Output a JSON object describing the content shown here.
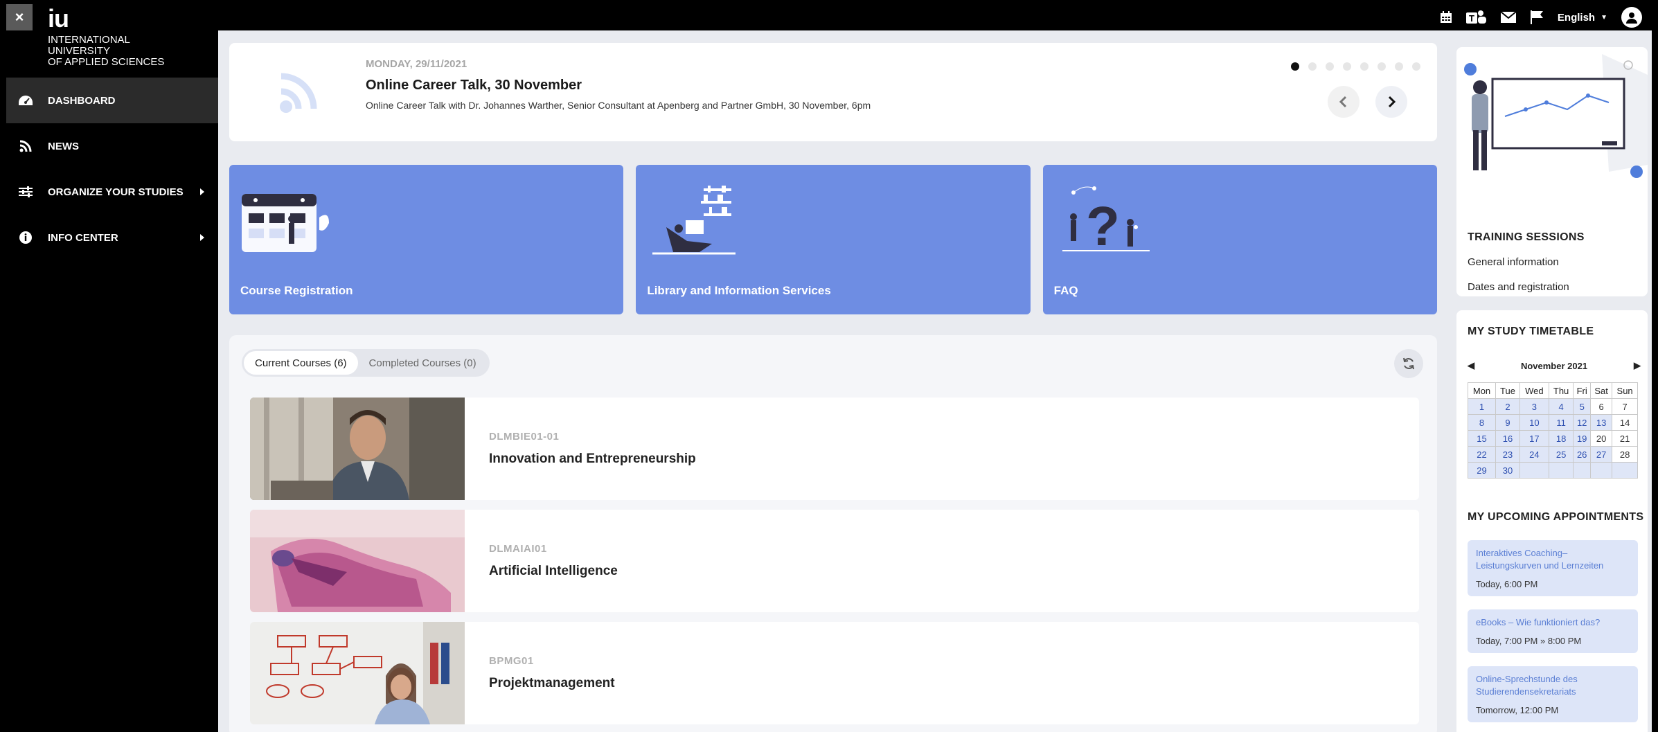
{
  "header": {
    "close_label": "×",
    "language": "English",
    "icons": [
      "calendar-icon",
      "teams-icon",
      "mail-icon",
      "flag-icon",
      "user-icon"
    ]
  },
  "sidebar": {
    "logo_text": "iu",
    "university_lines": [
      "INTERNATIONAL",
      "UNIVERSITY",
      "OF APPLIED SCIENCES"
    ],
    "items": [
      {
        "label": "DASHBOARD",
        "icon": "dashboard-icon",
        "active": true
      },
      {
        "label": "NEWS",
        "icon": "rss-icon"
      },
      {
        "label": "ORGANIZE YOUR STUDIES",
        "icon": "sliders-icon",
        "has_submenu": true
      },
      {
        "label": "INFO CENTER",
        "icon": "info-icon",
        "has_submenu": true
      }
    ]
  },
  "news": {
    "date": "MONDAY, 29/11/2021",
    "title": "Online Career Talk, 30 November",
    "description": "Online Career Talk with  Dr. Johannes Warther, Senior Consultant at Apenberg and Partner GmbH, 30 November, 6pm",
    "slide_count": 8,
    "active_slide": 1
  },
  "tiles": [
    {
      "label": "Course Registration"
    },
    {
      "label": "Library and Information Services"
    },
    {
      "label": "FAQ"
    }
  ],
  "courses": {
    "tab_current": "Current Courses (6)",
    "tab_completed": "Completed Courses (0)",
    "items": [
      {
        "code": "DLMBIE01-01",
        "name": "Innovation and Entrepreneurship"
      },
      {
        "code": "DLMAIAI01",
        "name": "Artificial Intelligence"
      },
      {
        "code": "BPMG01",
        "name": "Projektmanagement"
      }
    ]
  },
  "training": {
    "title": "TRAINING SESSIONS",
    "links": [
      "General information",
      "Dates and registration"
    ]
  },
  "timetable": {
    "title": "MY STUDY TIMETABLE",
    "month": "November 2021",
    "weekdays": [
      "Mon",
      "Tue",
      "Wed",
      "Thu",
      "Fri",
      "Sat",
      "Sun"
    ],
    "weeks": [
      [
        "1",
        "2",
        "3",
        "4",
        "5",
        "6",
        "7"
      ],
      [
        "8",
        "9",
        "10",
        "11",
        "12",
        "13",
        "14"
      ],
      [
        "15",
        "16",
        "17",
        "18",
        "19",
        "20",
        "21"
      ],
      [
        "22",
        "23",
        "24",
        "25",
        "26",
        "27",
        "28"
      ],
      [
        "29",
        "30",
        "",
        "",
        "",
        "",
        ""
      ]
    ]
  },
  "appointments": {
    "title": "MY UPCOMING APPOINTMENTS",
    "items": [
      {
        "title": "Interaktives Coaching– Leistungskurven und Lernzeiten",
        "time": "Today, 6:00 PM"
      },
      {
        "title": "eBooks – Wie funktioniert das?",
        "time": "Today, 7:00 PM » 8:00 PM"
      },
      {
        "title": "Online-Sprechstunde des Studierendensekretariats",
        "time": "Tomorrow, 12:00 PM"
      }
    ]
  }
}
